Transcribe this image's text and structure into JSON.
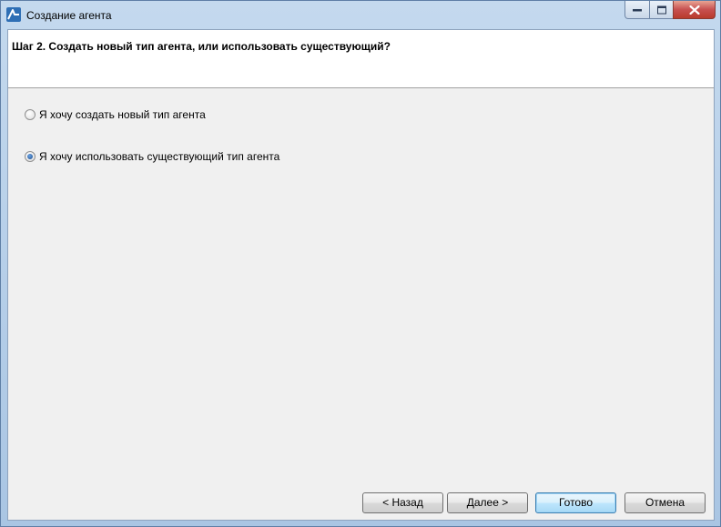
{
  "window": {
    "title": "Создание агента"
  },
  "header": {
    "step_title": "Шаг 2. Создать новый тип агента, или использовать существующий?"
  },
  "options": [
    {
      "label": "Я хочу создать новый тип агента",
      "checked": false
    },
    {
      "label": "Я хочу использовать существующий тип агента",
      "checked": true
    }
  ],
  "buttons": {
    "back": "< Назад",
    "next": "Далее >",
    "finish": "Готово",
    "cancel": "Отмена"
  },
  "icons": {
    "app": "app-logo-icon",
    "minimize": "minimize-icon",
    "maximize": "maximize-icon",
    "close": "close-icon"
  }
}
